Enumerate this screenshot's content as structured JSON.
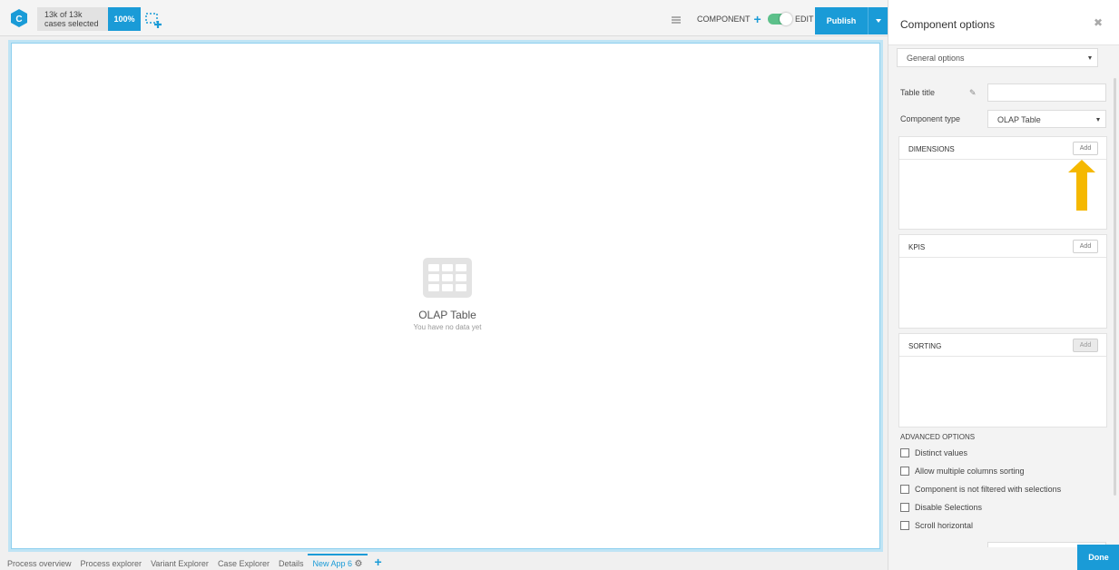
{
  "topbar": {
    "logo_letter": "C",
    "selection_line1": "13k of 13k",
    "selection_line2": "cases selected",
    "percent": "100%",
    "component_label": "COMPONENT",
    "edit_label": "EDIT",
    "publish_label": "Publish",
    "edit_toggle_on": true
  },
  "canvas": {
    "placeholder_title": "OLAP Table",
    "placeholder_subtitle": "You have no data yet"
  },
  "bottom_tabs": {
    "items": [
      "Process overview",
      "Process explorer",
      "Variant Explorer",
      "Case Explorer",
      "Details",
      "New App 6"
    ],
    "active": "New App 6",
    "add_label": "+"
  },
  "panel": {
    "title": "Component options",
    "close_glyph": "✖",
    "general_select": "General options",
    "table_title_label": "Table title",
    "table_title_value": "",
    "component_type_label": "Component type",
    "component_type_value": "OLAP Table",
    "sections": [
      {
        "title": "DIMENSIONS",
        "add_label": "Add"
      },
      {
        "title": "KPIS",
        "add_label": "Add"
      },
      {
        "title": "SORTING",
        "add_label": "Add"
      }
    ],
    "advanced_title": "ADVANCED OPTIONS",
    "advanced_options": [
      "Distinct values",
      "Allow multiple columns sorting",
      "Component is not filtered with selections",
      "Disable Selections",
      "Scroll horizontal"
    ],
    "done_label": "Done"
  },
  "colors": {
    "accent": "#1a9bd7",
    "toggle_on": "#5cc08a",
    "arrow": "#f5b800"
  }
}
